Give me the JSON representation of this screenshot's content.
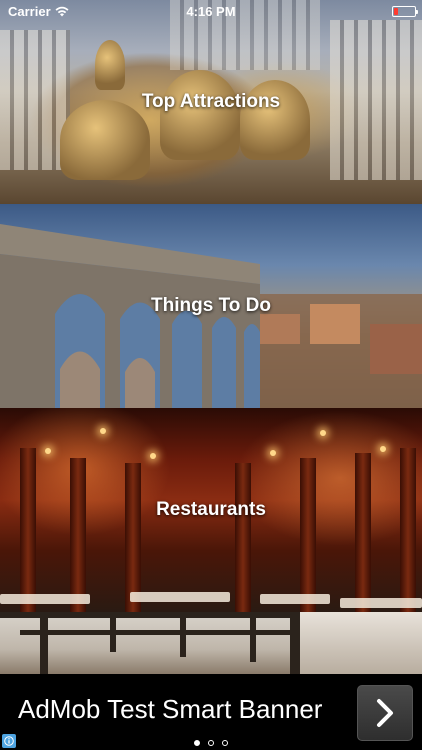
{
  "status_bar": {
    "carrier": "Carrier",
    "time": "4:16 PM",
    "battery_level": 0.18,
    "battery_color": "#ff3b30"
  },
  "tiles": [
    {
      "label": "Top Attractions"
    },
    {
      "label": "Things To Do"
    },
    {
      "label": "Restaurants"
    },
    {
      "label": ""
    }
  ],
  "ad_banner": {
    "text": "AdMob Test Smart Banner",
    "arrow_icon": "chevron-right-icon",
    "info_icon": "info-icon"
  },
  "pager": {
    "page_count": 3,
    "active_index": 0
  }
}
